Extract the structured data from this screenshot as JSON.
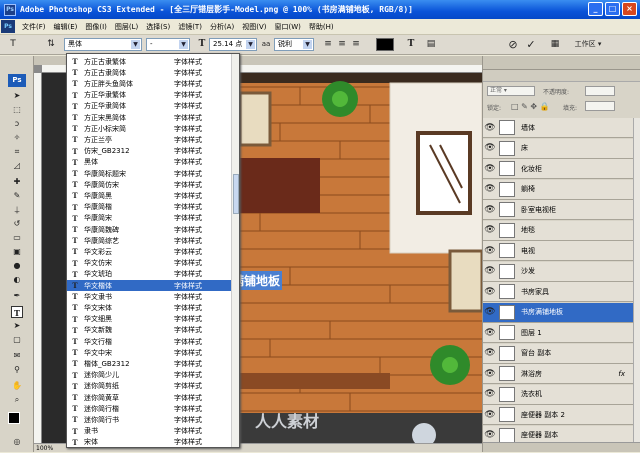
{
  "window": {
    "title": "Adobe Photoshop CS3 Extended - [全三厅错层影手-Model.png @ 100% (书房满铺地板, RGB/8)]",
    "controls": [
      "_",
      "□",
      "×"
    ]
  },
  "menu": [
    "文件(F)",
    "编辑(E)",
    "图像(I)",
    "图层(L)",
    "选择(S)",
    "滤镜(T)",
    "分析(A)",
    "视图(V)",
    "窗口(W)",
    "帮助(H)"
  ],
  "options": {
    "font_family": "黑体",
    "font_style": "-",
    "font_size": "25.14 点",
    "aa_label": "aa",
    "aa_mode": "锐利",
    "workspace": "工作区"
  },
  "tools": {
    "logo": "Ps"
  },
  "font_list": [
    {
      "name": "方正古隶繁体",
      "sample": "字体样式"
    },
    {
      "name": "方正古隶简体",
      "sample": "字体样式"
    },
    {
      "name": "方正胖头鱼简体",
      "sample": "字体样式"
    },
    {
      "name": "方正华隶繁体",
      "sample": "字体样式"
    },
    {
      "name": "方正华隶简体",
      "sample": "字体样式"
    },
    {
      "name": "方正宋黑简体",
      "sample": "字体样式"
    },
    {
      "name": "方正小标宋简",
      "sample": "字体样式"
    },
    {
      "name": "方正兰亭",
      "sample": "字体样式"
    },
    {
      "name": "仿宋_GB2312",
      "sample": "字体样式"
    },
    {
      "name": "黑体",
      "sample": "字体样式"
    },
    {
      "name": "华康简标题宋",
      "sample": "字体样式"
    },
    {
      "name": "华康简仿宋",
      "sample": "字体样式"
    },
    {
      "name": "华康简黑",
      "sample": "字体样式"
    },
    {
      "name": "华康简楷",
      "sample": "字体样式"
    },
    {
      "name": "华康简宋",
      "sample": "字体样式"
    },
    {
      "name": "华康简魏碑",
      "sample": "字体样式"
    },
    {
      "name": "华康简综艺",
      "sample": "字体样式"
    },
    {
      "name": "华文彩云",
      "sample": "字体样式"
    },
    {
      "name": "华文仿宋",
      "sample": "字体样式"
    },
    {
      "name": "华文琥珀",
      "sample": "字体样式"
    },
    {
      "name": "华文楷体",
      "sample": "字体样式"
    },
    {
      "name": "华文隶书",
      "sample": "字体样式"
    },
    {
      "name": "华文宋体",
      "sample": "字体样式"
    },
    {
      "name": "华文细黑",
      "sample": "字体样式"
    },
    {
      "name": "华文新魏",
      "sample": "字体样式"
    },
    {
      "name": "华文行楷",
      "sample": "字体样式"
    },
    {
      "name": "华文中宋",
      "sample": "字体样式"
    },
    {
      "name": "楷体_GB2312",
      "sample": "字体样式"
    },
    {
      "name": "迷你简少儿",
      "sample": "字体样式"
    },
    {
      "name": "迷你简剪纸",
      "sample": "字体样式"
    },
    {
      "name": "迷你简黄草",
      "sample": "字体样式"
    },
    {
      "name": "迷你简行楷",
      "sample": "字体样式"
    },
    {
      "name": "迷你简行书",
      "sample": "字体样式"
    },
    {
      "name": "隶书",
      "sample": "字体样式"
    },
    {
      "name": "宋体",
      "sample": "字体样式"
    }
  ],
  "font_list_selected": 20,
  "canvas_text": "书房满铺地板",
  "doc_status": "100%",
  "layers_panel": {
    "blend_mode": "正常",
    "opacity_label": "不透明度:",
    "lock_label": "锁定:",
    "fill_label": "填充:",
    "layers": [
      {
        "name": "墙体",
        "type": "image"
      },
      {
        "name": "床",
        "type": "image"
      },
      {
        "name": "化妆柜",
        "type": "image"
      },
      {
        "name": "躺椅",
        "type": "image"
      },
      {
        "name": "卧室电视柜",
        "type": "image"
      },
      {
        "name": "地毯",
        "type": "image"
      },
      {
        "name": "电视",
        "type": "image"
      },
      {
        "name": "沙发",
        "type": "image"
      },
      {
        "name": "书房家具",
        "type": "image"
      },
      {
        "name": "书房满铺地板",
        "type": "text",
        "active": true
      },
      {
        "name": "图层 1",
        "type": "image"
      },
      {
        "name": "窗台 副本",
        "type": "image"
      },
      {
        "name": "淋浴房",
        "type": "image",
        "fx": "fx"
      },
      {
        "name": "洗衣机",
        "type": "image"
      },
      {
        "name": "座便器 副本 2",
        "type": "image"
      },
      {
        "name": "座便器 副本",
        "type": "image"
      }
    ]
  },
  "watermark": "人人素材"
}
